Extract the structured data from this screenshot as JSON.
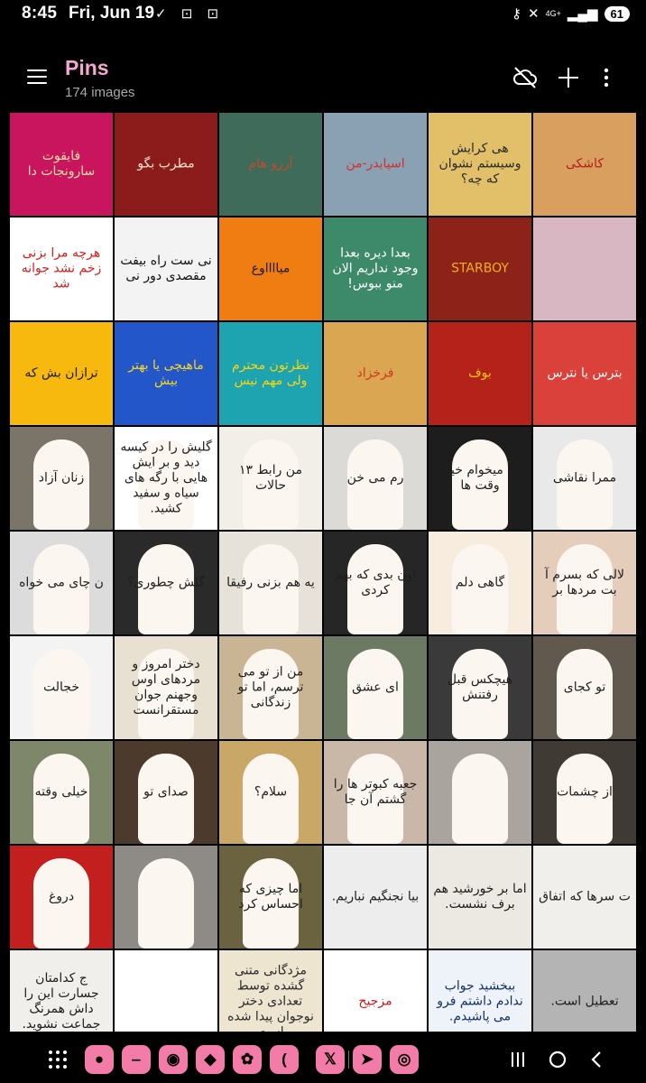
{
  "status_bar": {
    "time": "8:45",
    "date": "Fri, Jun 19",
    "left_icons": [
      "send-icon",
      "screen-record-icon",
      "screenshot-icon"
    ],
    "right_icons": [
      "key-icon",
      "mute-icon",
      "network-icon",
      "signal-icon"
    ],
    "network_type": "4G+",
    "battery": "61"
  },
  "app_bar": {
    "title": "Pins",
    "subtitle": "174 images",
    "actions": [
      "cloud-off-icon",
      "plus-icon",
      "more-vert-icon"
    ],
    "title_color": "#f5a7d4"
  },
  "tiles": [
    {
      "bg": "#c8155e",
      "fg": "#f6e3a8",
      "text": "فایقوت سارونجات دا"
    },
    {
      "bg": "#8c1c1c",
      "fg": "#f3e6cc",
      "text": "مطرب بگو"
    },
    {
      "bg": "#3e6b5a",
      "fg": "#c84a2e",
      "text": "آرزو هام"
    },
    {
      "bg": "#8aa0b3",
      "fg": "#d43028",
      "text": "اسپایدر-من"
    },
    {
      "bg": "#e2c06a",
      "fg": "#2b2b2b",
      "text": "هی کرایش وسیستم نشوان که چه؟"
    },
    {
      "bg": "#d89f5e",
      "fg": "#b51f1f",
      "text": "کاشکی"
    },
    {
      "bg": "#ffffff",
      "fg": "#d81c1c",
      "text": "هرچه مرا بزنی زخم نشد جوانه شد"
    },
    {
      "bg": "#f3f3f3",
      "fg": "#111111",
      "text": "نی ست راه بیفت مقصدی دور نی"
    },
    {
      "bg": "#f07d12",
      "fg": "#1b1b1b",
      "text": "میااااوع"
    },
    {
      "bg": "#3d8a6a",
      "fg": "#ffffff",
      "text": "بعدا دیره بعدا وجود نداریم الان منو ببوس!"
    },
    {
      "bg": "#8d2318",
      "fg": "#f2b01e",
      "text": "STARBOY"
    },
    {
      "bg": "#d9b7c2",
      "fg": "#5e1a2c",
      "text": ""
    },
    {
      "bg": "#f7b90e",
      "fg": "#1c1c1c",
      "text": "ترازان بش که"
    },
    {
      "bg": "#2356c9",
      "fg": "#f5d823",
      "text": "ماهیچی یا بهتر بیش"
    },
    {
      "bg": "#1ea3b0",
      "fg": "#f6d60f",
      "text": "نظرتون محترم ولی مهم نیس"
    },
    {
      "bg": "#dba652",
      "fg": "#d3381c",
      "text": "فرخزاد"
    },
    {
      "bg": "#b52219",
      "fg": "#f5c614",
      "text": "بوف"
    },
    {
      "bg": "#d9413a",
      "fg": "#ffffff",
      "text": "بترس یا نترس"
    },
    {
      "bg": "#7b7468",
      "fg": "#2f2b24",
      "text": "زنان آزاد"
    },
    {
      "bg": "#ffffff",
      "fg": "#222222",
      "text": "گلیش را در کیسه دید و بر ایش هایی با رگه های سیاه و سفید کشید."
    },
    {
      "bg": "#f2efe9",
      "fg": "#1f1f1f",
      "text": "من رابط ۱۳ حالات"
    },
    {
      "bg": "#dcdad6",
      "fg": "#222222",
      "text": "رم می خن"
    },
    {
      "bg": "#1d1d1d",
      "fg": "#eeeeee",
      "text": "اره میخوام خیلی وقت ها"
    },
    {
      "bg": "#e9e9e9",
      "fg": "#1f1f1f",
      "text": "ممرا نقاشی"
    },
    {
      "bg": "#dcdcdc",
      "fg": "#1b1b1b",
      "text": "ن چای می خواه"
    },
    {
      "bg": "#2a2a2a",
      "fg": "#ffffff",
      "text": "گلش چطوری؟"
    },
    {
      "bg": "#e6e1d9",
      "fg": "#b91f1f",
      "text": "یه هم بزنی رفیقا"
    },
    {
      "bg": "#262626",
      "fg": "#ffffff",
      "text": "اون بدی که بهم کردی"
    },
    {
      "bg": "#f7ecde",
      "fg": "#b72a1f",
      "text": "گاهی دلم"
    },
    {
      "bg": "#e5cdbb",
      "fg": "#b0261c",
      "text": "لالی که بسرم آ بت مردها بر"
    },
    {
      "bg": "#f3f3f3",
      "fg": "#c01717",
      "text": "خجالت"
    },
    {
      "bg": "#e8e1d1",
      "fg": "#1e1e1e",
      "text": "دختر امروز و مردهای اوس وجهنم جوان مستقرانست"
    },
    {
      "bg": "#c9b593",
      "fg": "#1c1c1c",
      "text": "من از تو می ترسم، اما تو زندگانی"
    },
    {
      "bg": "#6d7a63",
      "fg": "#c31d1d",
      "text": "ای عشق"
    },
    {
      "bg": "#3a3a3a",
      "fg": "#1e1e1e",
      "text": "هیچکس قبل رفتنش"
    },
    {
      "bg": "#61584e",
      "fg": "#1e1e1e",
      "text": "تو کجای"
    },
    {
      "bg": "#7f876a",
      "fg": "#1e1e1e",
      "text": "خیلی وقته"
    },
    {
      "bg": "#4c3a2c",
      "fg": "#1e1e1e",
      "text": "صدای تو"
    },
    {
      "bg": "#c9a766",
      "fg": "#1e1e1e",
      "text": "سلام؟"
    },
    {
      "bg": "#c9b7a8",
      "fg": "#1e1e1e",
      "text": "جعبه کبوتر ها را گشتم آن جا"
    },
    {
      "bg": "#aaa49e",
      "fg": "#1e1e1e",
      "text": ""
    },
    {
      "bg": "#3f3a33",
      "fg": "#1e1e1e",
      "text": "از چشمات"
    },
    {
      "bg": "#c31f1f",
      "fg": "#1e1e1e",
      "text": "دروغ"
    },
    {
      "bg": "#8e8a85",
      "fg": "#1e1e1e",
      "text": ""
    },
    {
      "bg": "#6b6340",
      "fg": "#1e1e1e",
      "text": "اما چیزی که احساس کرد"
    },
    {
      "bg": "#ededed",
      "fg": "#ffffff",
      "text": "بیا نجنگیم نباریم."
    },
    {
      "bg": "#ece9e2",
      "fg": "#1e1e1e",
      "text": "اما بر خورشید هم برف نشست."
    },
    {
      "bg": "#f0efeb",
      "fg": "#1e1e1e",
      "text": "ت سرها که اتفاق"
    },
    {
      "bg": "#f0efeb",
      "fg": "#1e1e1e",
      "text": "ج کدامتان جسارت این را داش همرنگ جماعت نشوید."
    },
    {
      "bg": "#ffffff",
      "fg": "#111111",
      "text": ""
    },
    {
      "bg": "#eee5d1",
      "fg": "#2a2a2a",
      "text": "مژدگانی متنی گشده توسط تعدادی دختر نوجوان پیدا شده است"
    },
    {
      "bg": "#ffffff",
      "fg": "#c61a1a",
      "text": "مزجیح"
    },
    {
      "bg": "#eef3f9",
      "fg": "#12306a",
      "text": "ببخشید جواب ندادم داشتم فرو می پاشیدم."
    },
    {
      "bg": "#b4b4b4",
      "fg": "#1e1e1e",
      "text": "تعطیل است."
    }
  ],
  "nav_bar": {
    "apps": [
      {
        "name": "messages-app-icon",
        "bg": "#f27ba7",
        "glyph": "●"
      },
      {
        "name": "calls-app-icon",
        "bg": "#f27ba7",
        "glyph": "‒"
      },
      {
        "name": "camera-app-icon",
        "bg": "#f27ba7",
        "glyph": "◉"
      },
      {
        "name": "leaf-app-icon",
        "bg": "#f27ba7",
        "glyph": "◆"
      },
      {
        "name": "flower-app-icon",
        "bg": "#f27ba7",
        "glyph": "✿"
      },
      {
        "name": "phone-app-icon",
        "bg": "#f27ba7",
        "glyph": "("
      },
      {
        "name": "x-app-icon",
        "bg": "#f27ba7",
        "glyph": "𝕏"
      },
      {
        "name": "telegram-app-icon",
        "bg": "#f27ba7",
        "glyph": "➤"
      },
      {
        "name": "instagram-app-icon",
        "bg": "#f27ba7",
        "glyph": "◎"
      }
    ],
    "system_buttons": [
      "recents-icon",
      "home-icon",
      "back-icon"
    ]
  }
}
